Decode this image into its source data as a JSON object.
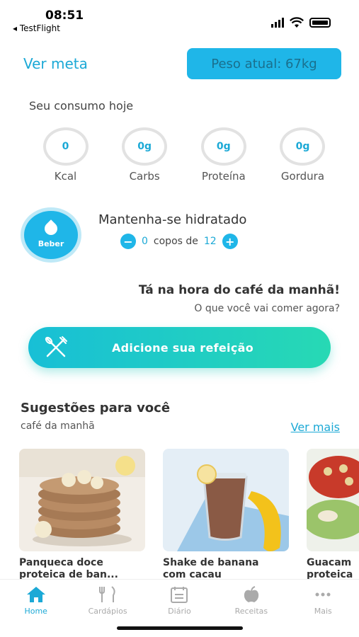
{
  "status": {
    "time": "08:51",
    "back_app": "◂ TestFlight"
  },
  "header": {
    "ver_meta": "Ver meta",
    "peso_atual": "Peso atual: 67kg"
  },
  "consumo": {
    "title": "Seu consumo hoje",
    "items": [
      {
        "value": "0",
        "label": "Kcal"
      },
      {
        "value": "0g",
        "label": "Carbs"
      },
      {
        "value": "0g",
        "label": "Proteína"
      },
      {
        "value": "0g",
        "label": "Gordura"
      }
    ]
  },
  "hidratacao": {
    "button_label": "Beber",
    "title": "Mantenha-se hidratado",
    "current": "0",
    "text": "copos de",
    "goal": "12"
  },
  "refeicao": {
    "title": "Tá na hora do café da manhã!",
    "subtitle": "O que você vai comer agora?",
    "button_label": "Adicione sua refeição"
  },
  "sugestoes": {
    "title": "Sugestões para você",
    "subtitle": "café da manhã",
    "ver_mais": "Ver mais",
    "cards": [
      {
        "title_line1": "Panqueca doce",
        "title_line2": "proteica de ban..."
      },
      {
        "title_line1": "Shake de banana",
        "title_line2": "com cacau"
      },
      {
        "title_line1": "Guacam",
        "title_line2": "proteica"
      }
    ]
  },
  "tabbar": {
    "items": [
      {
        "label": "Home",
        "icon": "home-icon",
        "active": true
      },
      {
        "label": "Cardápios",
        "icon": "cutlery-icon",
        "active": false
      },
      {
        "label": "Diário",
        "icon": "journal-icon",
        "active": false
      },
      {
        "label": "Receitas",
        "icon": "apple-icon",
        "active": false
      },
      {
        "label": "Mais",
        "icon": "more-icon",
        "active": false
      }
    ]
  },
  "colors": {
    "accent": "#1fb6e8",
    "accent_text": "#1ca9d6",
    "gradient_start": "#18bfd6",
    "gradient_end": "#27d9b4"
  }
}
